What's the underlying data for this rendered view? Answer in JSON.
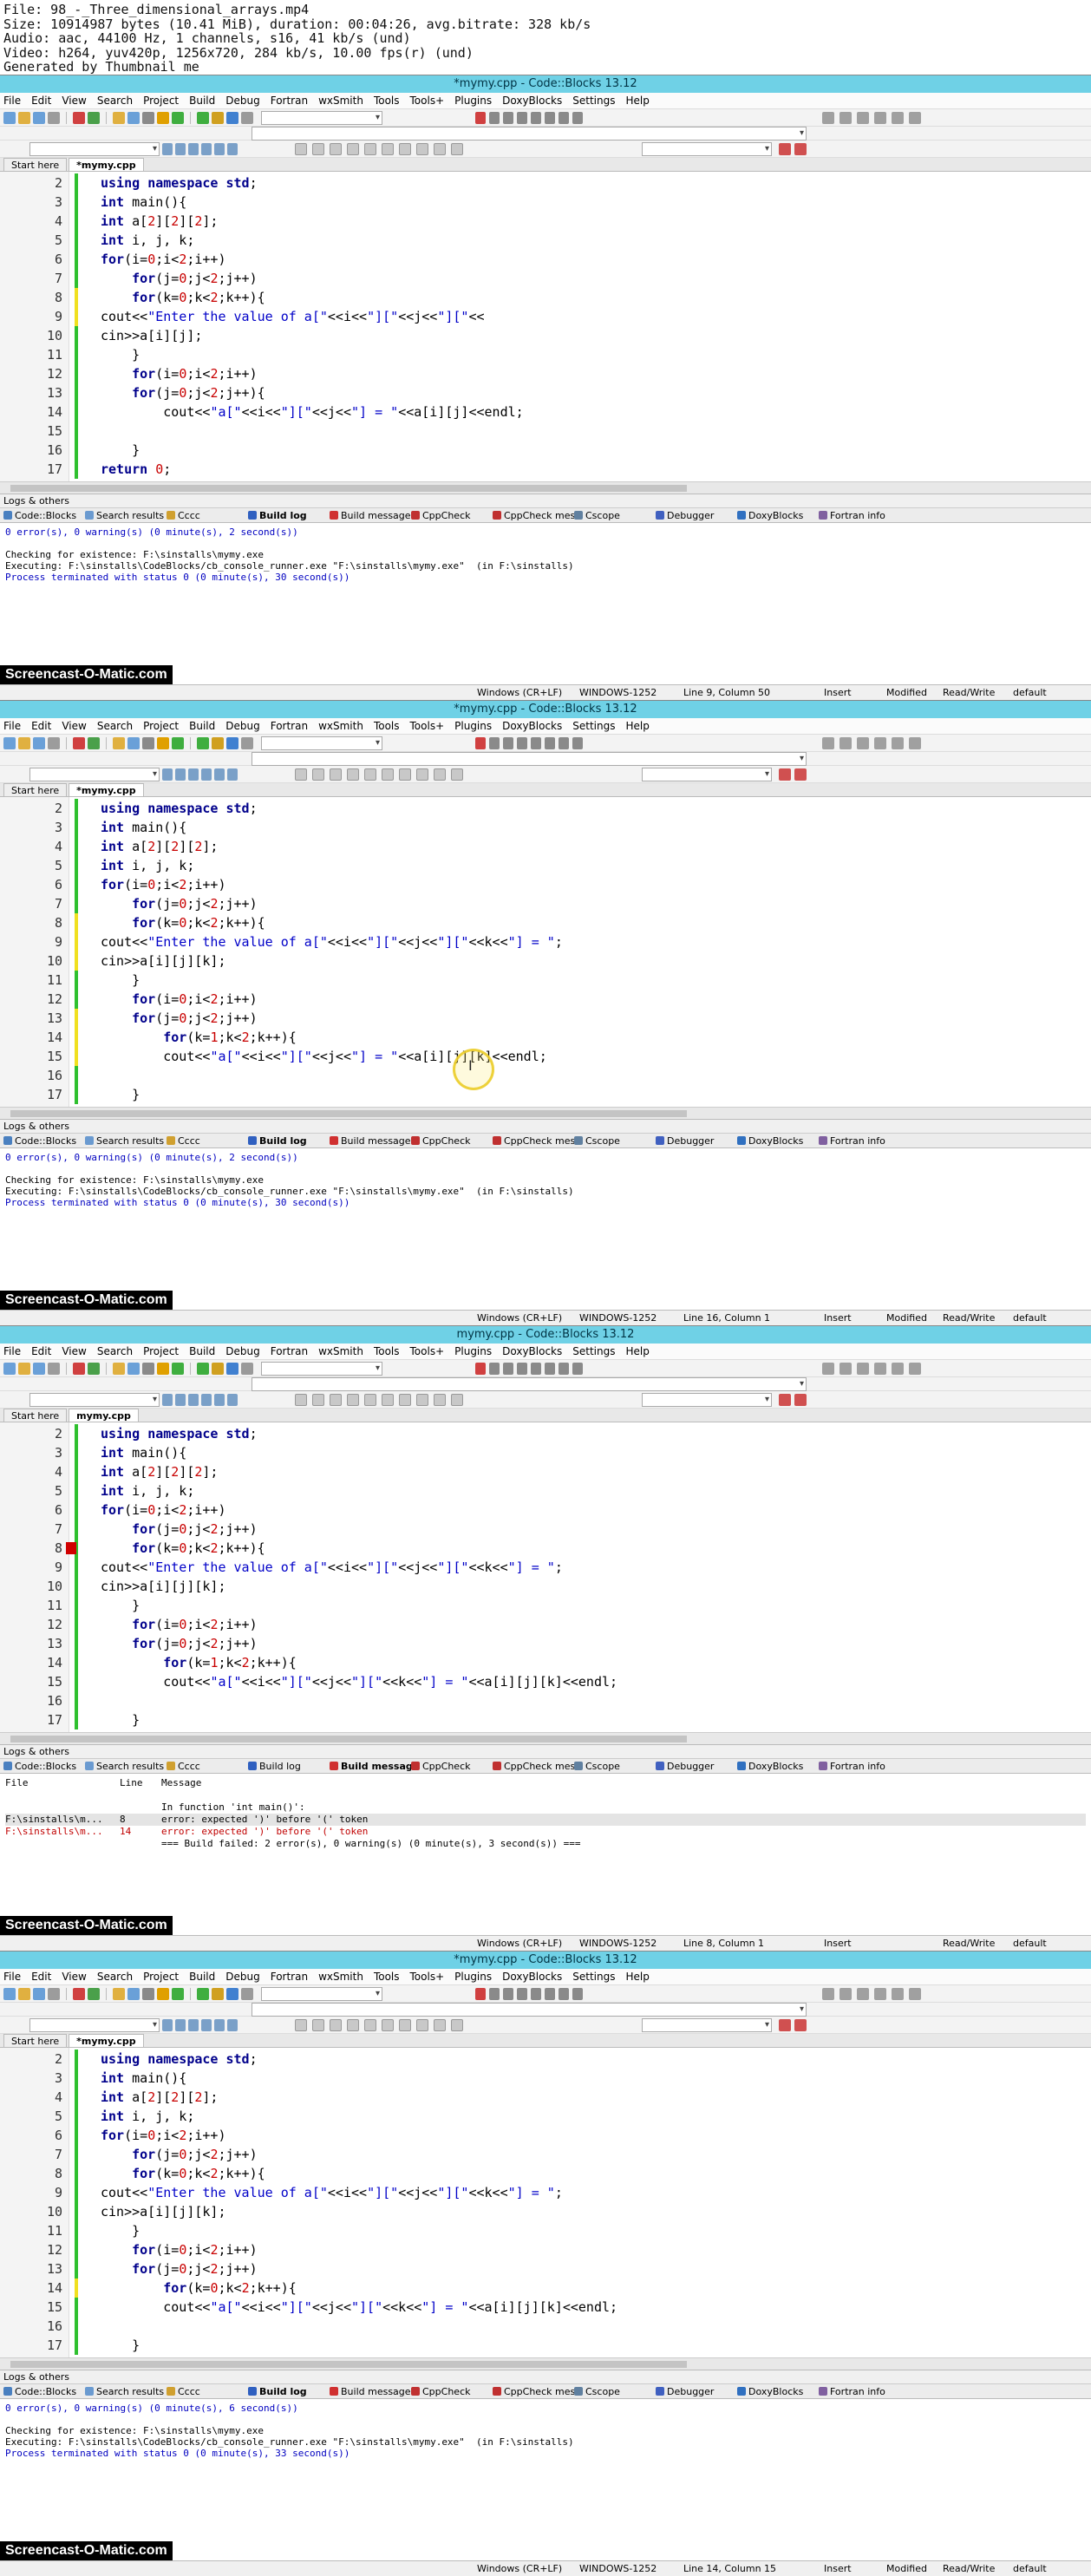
{
  "meta_lines": [
    "File: 98_-_Three_dimensional_arrays.mp4",
    "Size: 10914987 bytes (10.41 MiB), duration: 00:04:26, avg.bitrate: 328 kb/s",
    "Audio: aac, 44100 Hz, 1 channels, s16, 41 kb/s (und)",
    "Video: h264, yuv420p, 1256x720, 284 kb/s, 10.00 fps(r) (und)",
    "Generated by Thumbnail me"
  ],
  "menu": [
    "File",
    "Edit",
    "View",
    "Search",
    "Project",
    "Build",
    "Debug",
    "Fortran",
    "wxSmith",
    "Tools",
    "Tools+",
    "Plugins",
    "DoxyBlocks",
    "Settings",
    "Help"
  ],
  "start_tab": "Start here",
  "logs_title": "Logs & others",
  "log_tabs": [
    "Code::Blocks",
    "Search results",
    "Cccc",
    "Build log",
    "Build messages",
    "CppCheck",
    "CppCheck messages",
    "Cscope",
    "Debugger",
    "DoxyBlocks",
    "Fortran info"
  ],
  "brand": "Screencast-O-Matic.com",
  "status_common": {
    "eol": "Windows (CR+LF)",
    "enc": "WINDOWS-1252",
    "ins": "Insert",
    "rw": "Read/Write",
    "prof": "default"
  },
  "frames": [
    {
      "title": "*mymy.cpp - Code::Blocks 13.12",
      "file_tab": "*mymy.cpp",
      "lines": [
        {
          "n": "2",
          "t": "using namespace std;",
          "m": "saved"
        },
        {
          "n": "3",
          "t": "int main(){",
          "m": "saved"
        },
        {
          "n": "4",
          "t": "int a[2][2][2];",
          "m": "saved"
        },
        {
          "n": "5",
          "t": "int i, j, k;",
          "m": "saved"
        },
        {
          "n": "6",
          "t": "for(i=0;i<2;i++)",
          "m": "saved"
        },
        {
          "n": "7",
          "t": "    for(j=0;j<2;j++)",
          "m": "saved"
        },
        {
          "n": "8",
          "t": "    for(k=0;k<2;k++){",
          "m": "mod"
        },
        {
          "n": "9",
          "t": "cout<<\"Enter the value of a[\"<<i<<\"][\"<<j<<\"][\"<<",
          "m": "mod"
        },
        {
          "n": "10",
          "t": "cin>>a[i][j];",
          "m": "saved"
        },
        {
          "n": "11",
          "t": "    }",
          "m": "saved"
        },
        {
          "n": "12",
          "t": "    for(i=0;i<2;i++)",
          "m": "saved"
        },
        {
          "n": "13",
          "t": "    for(j=0;j<2;j++){",
          "m": "saved"
        },
        {
          "n": "14",
          "t": "        cout<<\"a[\"<<i<<\"][\"<<j<<\"] = \"<<a[i][j]<<endl;",
          "m": "saved"
        },
        {
          "n": "15",
          "t": "",
          "m": "saved"
        },
        {
          "n": "16",
          "t": "    }",
          "m": "saved"
        },
        {
          "n": "17",
          "t": "return 0;",
          "m": "saved"
        }
      ],
      "active_log": "Build log",
      "log_lines": [
        {
          "t": "0 error(s), 0 warning(s) (0 minute(s), 2 second(s))",
          "c": "blue"
        },
        {
          "t": "",
          "c": ""
        },
        {
          "t": "Checking for existence: F:\\sinstalls\\mymy.exe",
          "c": ""
        },
        {
          "t": "Executing: F:\\sinstalls\\CodeBlocks/cb_console_runner.exe \"F:\\sinstalls\\mymy.exe\"  (in F:\\sinstalls)",
          "c": ""
        },
        {
          "t": "Process terminated with status 0 (0 minute(s), 30 second(s))",
          "c": "blue"
        }
      ],
      "status": {
        "pos": "Line 9, Column 50",
        "mod": "Modified"
      }
    },
    {
      "title": "*mymy.cpp - Code::Blocks 13.12",
      "file_tab": "*mymy.cpp",
      "lines": [
        {
          "n": "2",
          "t": "using namespace std;",
          "m": "saved"
        },
        {
          "n": "3",
          "t": "int main(){",
          "m": "saved"
        },
        {
          "n": "4",
          "t": "int a[2][2][2];",
          "m": "saved"
        },
        {
          "n": "5",
          "t": "int i, j, k;",
          "m": "saved"
        },
        {
          "n": "6",
          "t": "for(i=0;i<2;i++)",
          "m": "saved"
        },
        {
          "n": "7",
          "t": "    for(j=0;j<2;j++)",
          "m": "saved"
        },
        {
          "n": "8",
          "t": "    for(k=0;k<2;k++){",
          "m": "mod"
        },
        {
          "n": "9",
          "t": "cout<<\"Enter the value of a[\"<<i<<\"][\"<<j<<\"][\"<<k<<\"] = \";",
          "m": "mod"
        },
        {
          "n": "10",
          "t": "cin>>a[i][j][k];",
          "m": "mod"
        },
        {
          "n": "11",
          "t": "    }",
          "m": "saved"
        },
        {
          "n": "12",
          "t": "    for(i=0;i<2;i++)",
          "m": "saved"
        },
        {
          "n": "13",
          "t": "    for(j=0;j<2;j++)",
          "m": "mod"
        },
        {
          "n": "14",
          "t": "        for(k=1;k<2;k++){",
          "m": "mod"
        },
        {
          "n": "15",
          "t": "        cout<<\"a[\"<<i<<\"][\"<<j<<\"] = \"<<a[i][j][k]<<endl;",
          "m": "mod"
        },
        {
          "n": "16",
          "t": "",
          "m": "saved"
        },
        {
          "n": "17",
          "t": "    }",
          "m": "saved"
        }
      ],
      "active_log": "Build log",
      "log_lines": [
        {
          "t": "0 error(s), 0 warning(s) (0 minute(s), 2 second(s))",
          "c": "blue"
        },
        {
          "t": "",
          "c": ""
        },
        {
          "t": "Checking for existence: F:\\sinstalls\\mymy.exe",
          "c": ""
        },
        {
          "t": "Executing: F:\\sinstalls\\CodeBlocks/cb_console_runner.exe \"F:\\sinstalls\\mymy.exe\"  (in F:\\sinstalls)",
          "c": ""
        },
        {
          "t": "Process terminated with status 0 (0 minute(s), 30 second(s))",
          "c": "blue"
        }
      ],
      "status": {
        "pos": "Line 16, Column 1",
        "mod": "Modified"
      }
    },
    {
      "title": "mymy.cpp - Code::Blocks 13.12",
      "file_tab": "mymy.cpp",
      "lines": [
        {
          "n": "2",
          "t": "using namespace std;",
          "m": "saved"
        },
        {
          "n": "3",
          "t": "int main(){",
          "m": "saved"
        },
        {
          "n": "4",
          "t": "int a[2][2][2];",
          "m": "saved"
        },
        {
          "n": "5",
          "t": "int i, j, k;",
          "m": "saved"
        },
        {
          "n": "6",
          "t": "for(i=0;i<2;i++)",
          "m": "saved"
        },
        {
          "n": "7",
          "t": "    for(j=0;j<2;j++)",
          "m": "saved"
        },
        {
          "n": "8",
          "t": "    for(k=0;k<2;k++){",
          "m": "saved"
        },
        {
          "n": "9",
          "t": "cout<<\"Enter the value of a[\"<<i<<\"][\"<<j<<\"][\"<<k<<\"] = \";",
          "m": "saved"
        },
        {
          "n": "10",
          "t": "cin>>a[i][j][k];",
          "m": "saved"
        },
        {
          "n": "11",
          "t": "    }",
          "m": "saved"
        },
        {
          "n": "12",
          "t": "    for(i=0;i<2;i++)",
          "m": "saved"
        },
        {
          "n": "13",
          "t": "    for(j=0;j<2;j++)",
          "m": "saved"
        },
        {
          "n": "14",
          "t": "        for(k=1;k<2;k++){",
          "m": "saved"
        },
        {
          "n": "15",
          "t": "        cout<<\"a[\"<<i<<\"][\"<<j<<\"][\"<<k<<\"] = \"<<a[i][j][k]<<endl;",
          "m": "saved"
        },
        {
          "n": "16",
          "t": "",
          "m": "saved"
        },
        {
          "n": "17",
          "t": "    }",
          "m": "saved"
        }
      ],
      "active_log": "Build messages",
      "bm_header": [
        "File",
        "Line",
        "Message"
      ],
      "bm_rows": [
        {
          "f": "",
          "l": "",
          "m": "In function 'int main()':",
          "c": "",
          "hl": false
        },
        {
          "f": "F:\\sinstalls\\m...",
          "l": "8",
          "m": "error: expected ')' before '(' token",
          "c": "",
          "hl": true
        },
        {
          "f": "F:\\sinstalls\\m...",
          "l": "14",
          "m": "error: expected ')' before '(' token",
          "c": "red",
          "hl": false
        },
        {
          "f": "",
          "l": "",
          "m": "=== Build failed: 2 error(s), 0 warning(s) (0 minute(s), 3 second(s)) ===",
          "c": "",
          "hl": false
        }
      ],
      "status": {
        "pos": "Line 8, Column 1",
        "mod": ""
      }
    },
    {
      "title": "*mymy.cpp - Code::Blocks 13.12",
      "file_tab": "*mymy.cpp",
      "lines": [
        {
          "n": "2",
          "t": "using namespace std;",
          "m": "saved"
        },
        {
          "n": "3",
          "t": "int main(){",
          "m": "saved"
        },
        {
          "n": "4",
          "t": "int a[2][2][2];",
          "m": "saved"
        },
        {
          "n": "5",
          "t": "int i, j, k;",
          "m": "saved"
        },
        {
          "n": "6",
          "t": "for(i=0;i<2;i++)",
          "m": "saved"
        },
        {
          "n": "7",
          "t": "    for(j=0;j<2;j++)",
          "m": "saved"
        },
        {
          "n": "8",
          "t": "    for(k=0;k<2;k++){",
          "m": "saved"
        },
        {
          "n": "9",
          "t": "cout<<\"Enter the value of a[\"<<i<<\"][\"<<j<<\"][\"<<k<<\"] = \";",
          "m": "saved"
        },
        {
          "n": "10",
          "t": "cin>>a[i][j][k];",
          "m": "saved"
        },
        {
          "n": "11",
          "t": "    }",
          "m": "saved"
        },
        {
          "n": "12",
          "t": "    for(i=0;i<2;i++)",
          "m": "saved"
        },
        {
          "n": "13",
          "t": "    for(j=0;j<2;j++)",
          "m": "saved"
        },
        {
          "n": "14",
          "t": "        for(k=0;k<2;k++){",
          "m": "mod"
        },
        {
          "n": "15",
          "t": "        cout<<\"a[\"<<i<<\"][\"<<j<<\"][\"<<k<<\"] = \"<<a[i][j][k]<<endl;",
          "m": "saved"
        },
        {
          "n": "16",
          "t": "",
          "m": "saved"
        },
        {
          "n": "17",
          "t": "    }",
          "m": "saved"
        }
      ],
      "active_log": "Build log",
      "log_lines": [
        {
          "t": "0 error(s), 0 warning(s) (0 minute(s), 6 second(s))",
          "c": "blue"
        },
        {
          "t": "",
          "c": ""
        },
        {
          "t": "Checking for existence: F:\\sinstalls\\mymy.exe",
          "c": ""
        },
        {
          "t": "Executing: F:\\sinstalls\\CodeBlocks/cb_console_runner.exe \"F:\\sinstalls\\mymy.exe\"  (in F:\\sinstalls)",
          "c": ""
        },
        {
          "t": "Process terminated with status 0 (0 minute(s), 33 second(s))",
          "c": "blue"
        }
      ],
      "status": {
        "pos": "Line 14, Column 15",
        "mod": "Modified"
      }
    }
  ]
}
